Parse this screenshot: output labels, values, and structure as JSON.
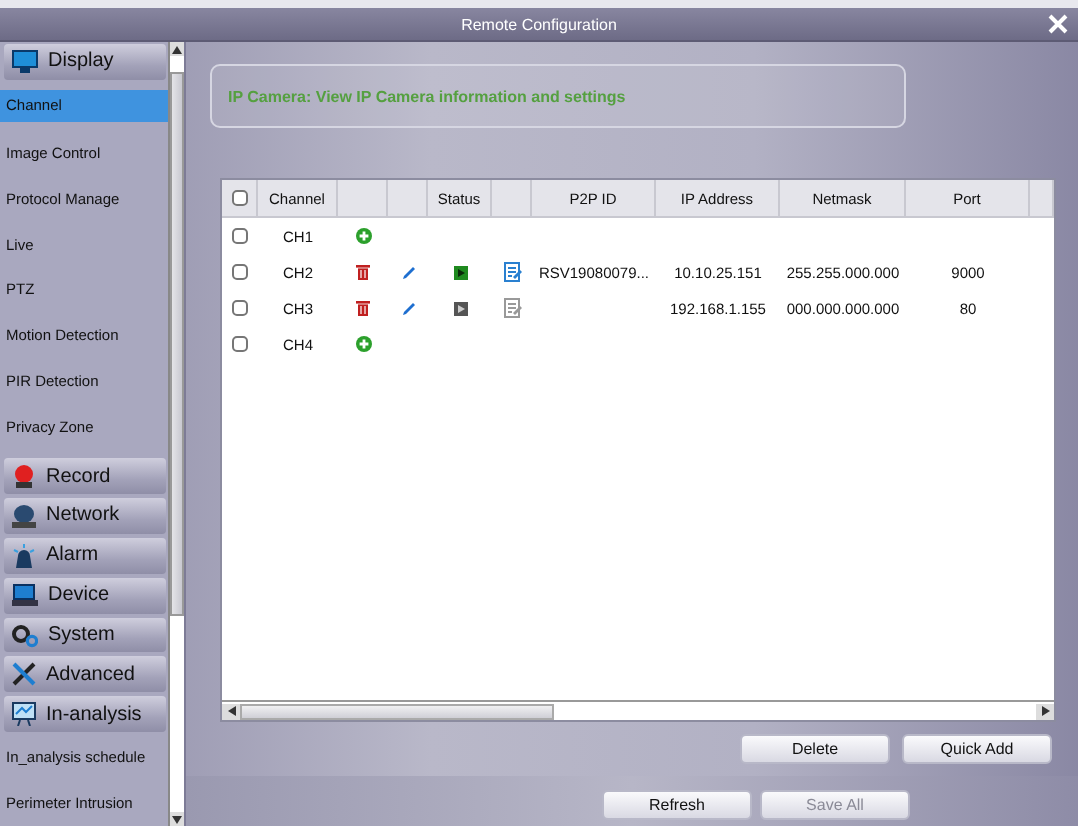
{
  "window": {
    "title": "Remote Configuration"
  },
  "sidebar": {
    "groups": [
      {
        "label": "Display",
        "expanded": true,
        "items": [
          {
            "label": "Channel",
            "selected": true
          },
          {
            "label": "Image Control",
            "selected": false
          },
          {
            "label": "Protocol Manage",
            "selected": false
          },
          {
            "label": "Live",
            "selected": false
          },
          {
            "label": "PTZ",
            "selected": false
          },
          {
            "label": "Motion Detection",
            "selected": false
          },
          {
            "label": "PIR Detection",
            "selected": false
          },
          {
            "label": "Privacy Zone",
            "selected": false
          }
        ]
      },
      {
        "label": "Record"
      },
      {
        "label": "Network"
      },
      {
        "label": "Alarm"
      },
      {
        "label": "Device"
      },
      {
        "label": "System"
      },
      {
        "label": "Advanced"
      },
      {
        "label": "In-analysis",
        "expanded": true,
        "items": [
          {
            "label": "In_analysis schedule",
            "selected": false
          },
          {
            "label": "Perimeter Intrusion",
            "selected": false
          }
        ]
      }
    ]
  },
  "info": {
    "text": "IP Camera: View IP Camera information and settings"
  },
  "table": {
    "select_all_checked": false,
    "columns": [
      {
        "label": "Channel"
      },
      {
        "label": "Status"
      },
      {
        "label": "P2P ID"
      },
      {
        "label": "IP Address"
      },
      {
        "label": "Netmask"
      },
      {
        "label": "Port"
      }
    ],
    "rows": [
      {
        "kind": "empty",
        "checked": false,
        "channel": "CH1"
      },
      {
        "kind": "camera",
        "checked": false,
        "channel": "CH2",
        "online": true,
        "p2p_id": "RSV19080079...",
        "ip_address": "10.10.25.151",
        "netmask": "255.255.000.000",
        "port": "9000"
      },
      {
        "kind": "camera",
        "checked": false,
        "channel": "CH3",
        "online": false,
        "ip_address": "192.168.1.155",
        "netmask": "000.000.000.000",
        "port": "80"
      },
      {
        "kind": "empty",
        "checked": false,
        "channel": "CH4"
      }
    ]
  },
  "actions": [
    {
      "label": "Delete",
      "disabled": false
    },
    {
      "label": "Quick Add",
      "disabled": false
    }
  ],
  "footer_buttons": [
    {
      "label": "Refresh",
      "disabled": false
    },
    {
      "label": "Save All",
      "disabled": true
    }
  ]
}
